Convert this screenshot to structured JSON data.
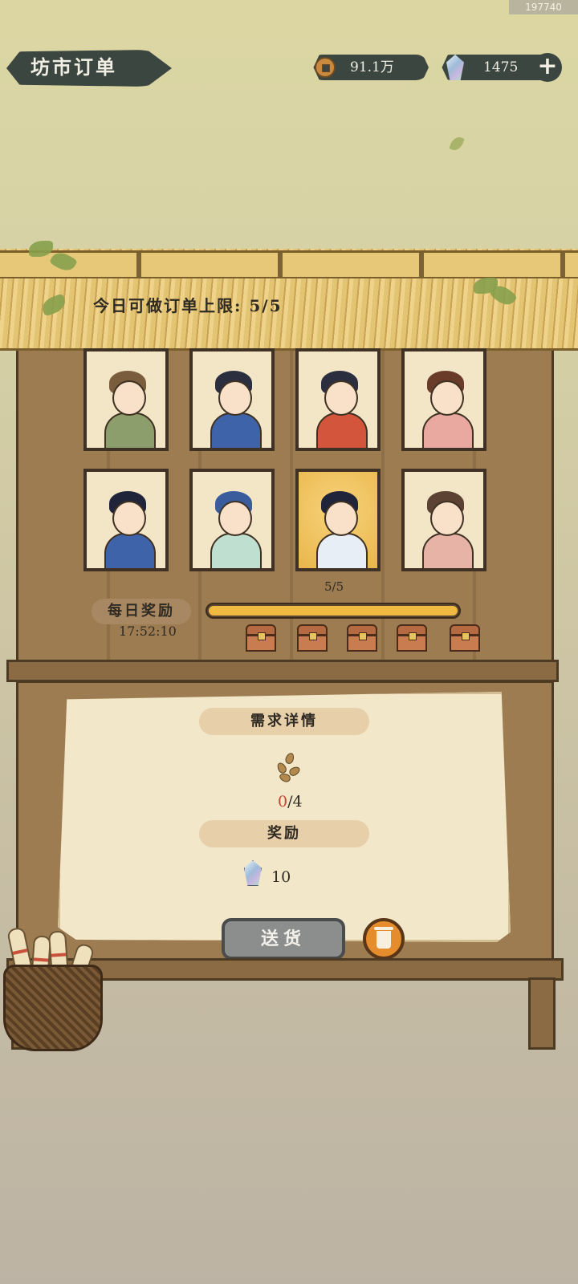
{
  "build_id": "197740",
  "header": {
    "title": "坊市订单",
    "coins": "91.1万",
    "gems": "1475",
    "add_label": "+"
  },
  "stall": {
    "limit_text": "今日可做订单上限: 5/5",
    "customers": [
      {
        "id": "farmer-woman",
        "hair": "#7a5d3d",
        "robe": "#8b9e6b",
        "selected": false
      },
      {
        "id": "boy-with-candy",
        "hair": "#2b2e3f",
        "robe": "#3f63a8",
        "selected": false
      },
      {
        "id": "merchant-with-abacus",
        "hair": "#2b2e3f",
        "robe": "#d2553c",
        "selected": false
      },
      {
        "id": "girl-with-fan",
        "hair": "#6b3b2a",
        "robe": "#e9a9a0",
        "selected": false
      },
      {
        "id": "young-swordsman",
        "hair": "#20243a",
        "robe": "#3f63a8",
        "selected": false
      },
      {
        "id": "blue-dragon",
        "hair": "#3a5b9c",
        "robe": "#bfe0d0",
        "selected": false
      },
      {
        "id": "young-scholar",
        "hair": "#20243a",
        "robe": "#e8eef5",
        "selected": true
      },
      {
        "id": "girl-with-flower-fan",
        "hair": "#5b4232",
        "robe": "#e7b3a6",
        "selected": false
      }
    ],
    "daily_reward": {
      "label": "每日奖励",
      "timer": "17:52:10",
      "progress_text": "5/5",
      "progress": 1.0,
      "chest_count": 5
    }
  },
  "order": {
    "requirement_title": "需求详情",
    "item_icon": "seeds-icon",
    "have": "0",
    "need": "/4",
    "reward_title": "奖励",
    "reward_icon": "gem-icon",
    "reward_amount": "10",
    "deliver_label": "送货",
    "discard_icon": "trash-icon"
  }
}
